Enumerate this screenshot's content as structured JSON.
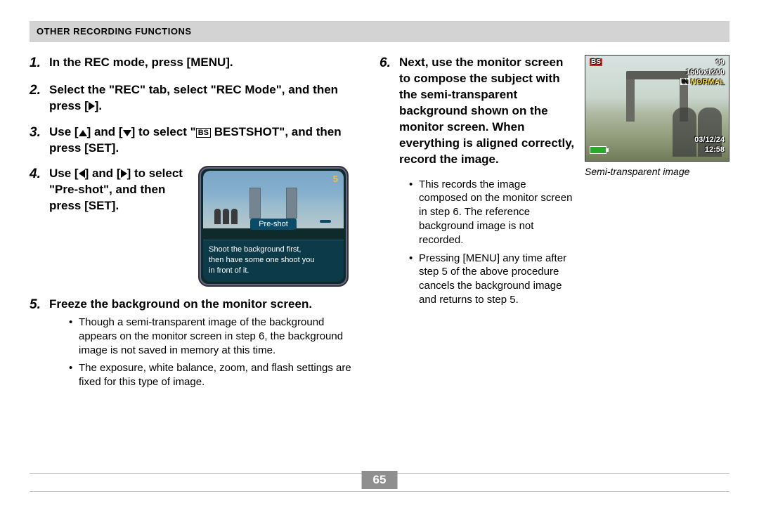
{
  "header": {
    "title": "OTHER RECORDING FUNCTIONS"
  },
  "page_number": "65",
  "steps": {
    "s1": {
      "num": "1.",
      "head": "In the REC mode, press [MENU]."
    },
    "s2": {
      "num": "2.",
      "head_a": "Select the \"REC\" tab, select \"REC Mode\", and then press [",
      "head_b": "]."
    },
    "s3": {
      "num": "3.",
      "head_a": "Use [",
      "head_b": "] and [",
      "head_c": "] to select \"",
      "head_d": " BESTSHOT\", and then press [SET]."
    },
    "s4": {
      "num": "4.",
      "head_a": "Use [",
      "head_b": "] and [",
      "head_c": "] to select \"Pre-shot\", and then press [SET]."
    },
    "s5": {
      "num": "5.",
      "head": "Freeze the background on the monitor screen.",
      "b1": "Though a semi-transparent image of the background appears on the monitor screen in step 6, the background image is not saved in memory at this time.",
      "b2": "The exposure, white balance, zoom, and flash settings are fixed for this type of image."
    },
    "s6": {
      "num": "6.",
      "head": "Next, use the monitor screen to compose the subject with the semi-transparent background shown on the monitor screen. When everything is aligned correctly, record the image.",
      "b1": "This records the image composed on the monitor screen in step 6. The reference background image is not recorded.",
      "b2": "Pressing [MENU] any time after step 5 of the above procedure cancels the background image and returns to step 5."
    }
  },
  "lcd": {
    "number": "5",
    "label": "Pre-shot",
    "msg_l1": "Shoot the background first,",
    "msg_l2": "then have some one shoot you",
    "msg_l3": "in front of it."
  },
  "preview": {
    "bs": "BS",
    "shots": "99",
    "res": "1600x1200",
    "quality": "NORMAL",
    "in": "IN",
    "date": "03/12/24",
    "time": "12:58",
    "caption": "Semi-transparent image"
  },
  "icons": {
    "bs": "BS"
  }
}
